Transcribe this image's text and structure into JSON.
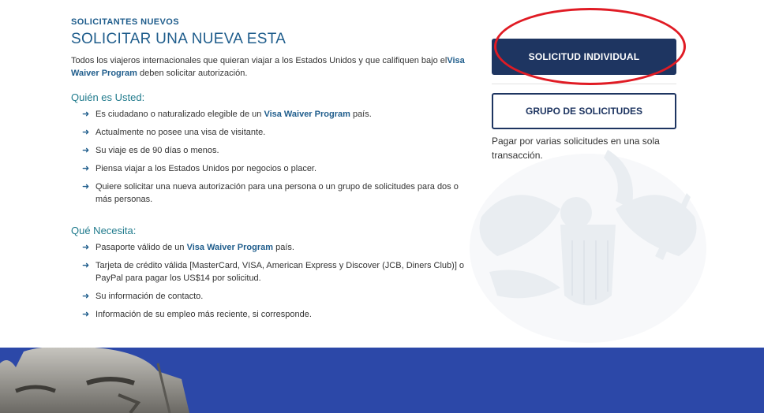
{
  "header": {
    "eyebrow": "SOLICITANTES NUEVOS",
    "title": "SOLICITAR UNA NUEVA ESTA"
  },
  "intro": {
    "before": "Todos los viajeros internacionales que quieran viajar a los Estados Unidos y que califiquen bajo el",
    "program": "Visa Waiver Program",
    "after": " deben solicitar autorización."
  },
  "who": {
    "title": "Quién es Usted:",
    "items": {
      "i0": {
        "before": "Es ciudadano o naturalizado elegible de un ",
        "program": "Visa Waiver Program",
        "after": " país."
      },
      "i1": {
        "text": "Actualmente no posee una visa de visitante."
      },
      "i2": {
        "text": "Su viaje es de 90 días o menos."
      },
      "i3": {
        "text": "Piensa viajar a los Estados Unidos por negocios o placer."
      },
      "i4": {
        "text": "Quiere solicitar una nueva autorización para una persona o un grupo de solicitudes para dos o más personas."
      }
    }
  },
  "needs": {
    "title": "Qué Necesita:",
    "items": {
      "i0": {
        "before": "Pasaporte válido de un ",
        "program": "Visa Waiver Program",
        "after": " país."
      },
      "i1": {
        "text": "Tarjeta de crédito válida [MasterCard, VISA, American Express y Discover (JCB, Diners Club)] o PayPal para pagar los US$14 por solicitud."
      },
      "i2": {
        "text": "Su información de contacto."
      },
      "i3": {
        "text": "Información de su empleo más reciente, si corresponde."
      }
    }
  },
  "actions": {
    "individual_label": "SOLICITUD INDIVIDUAL",
    "group_label": "GRUPO DE SOLICITUDES",
    "group_note": "Pagar por varias solicitudes en una sola transacción."
  },
  "theme": {
    "primary": "#1e3561",
    "link": "#1f5d8c",
    "highlight": "#e01b24",
    "banner": "#2c48a8"
  },
  "icons": {
    "bullet": "arrow-right-icon",
    "seal": "eagle-seal-icon"
  }
}
